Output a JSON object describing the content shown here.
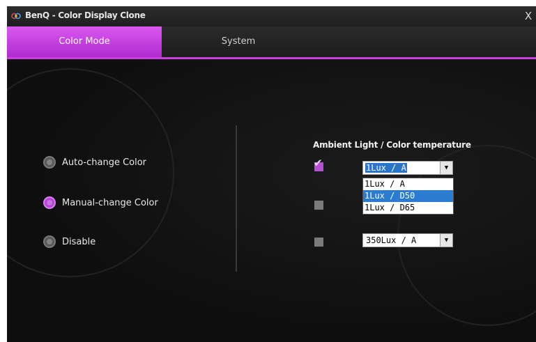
{
  "window": {
    "title": "BenQ - Color Display Clone",
    "close_label": "X"
  },
  "tabs": [
    {
      "label": "Color Mode",
      "active": true
    },
    {
      "label": "System",
      "active": false
    }
  ],
  "color_mode": {
    "options": [
      {
        "label": "Auto-change Color",
        "checked": false
      },
      {
        "label": "Manual-change Color",
        "checked": true
      },
      {
        "label": "Disable",
        "checked": false
      }
    ]
  },
  "ambient": {
    "title": "Ambient Light / Color temperature",
    "rows": [
      {
        "checked": true,
        "value": "1Lux / A"
      },
      {
        "checked": false,
        "value": ""
      },
      {
        "checked": false,
        "value": "350Lux / A"
      }
    ],
    "dropdown_options": [
      "1Lux / A",
      "1Lux / D50",
      "1Lux / D65"
    ],
    "dropdown_selected": "1Lux / D50"
  },
  "colors": {
    "accent": "#c83ee0",
    "tab_active": "#c64ae3",
    "background": "#121212"
  }
}
